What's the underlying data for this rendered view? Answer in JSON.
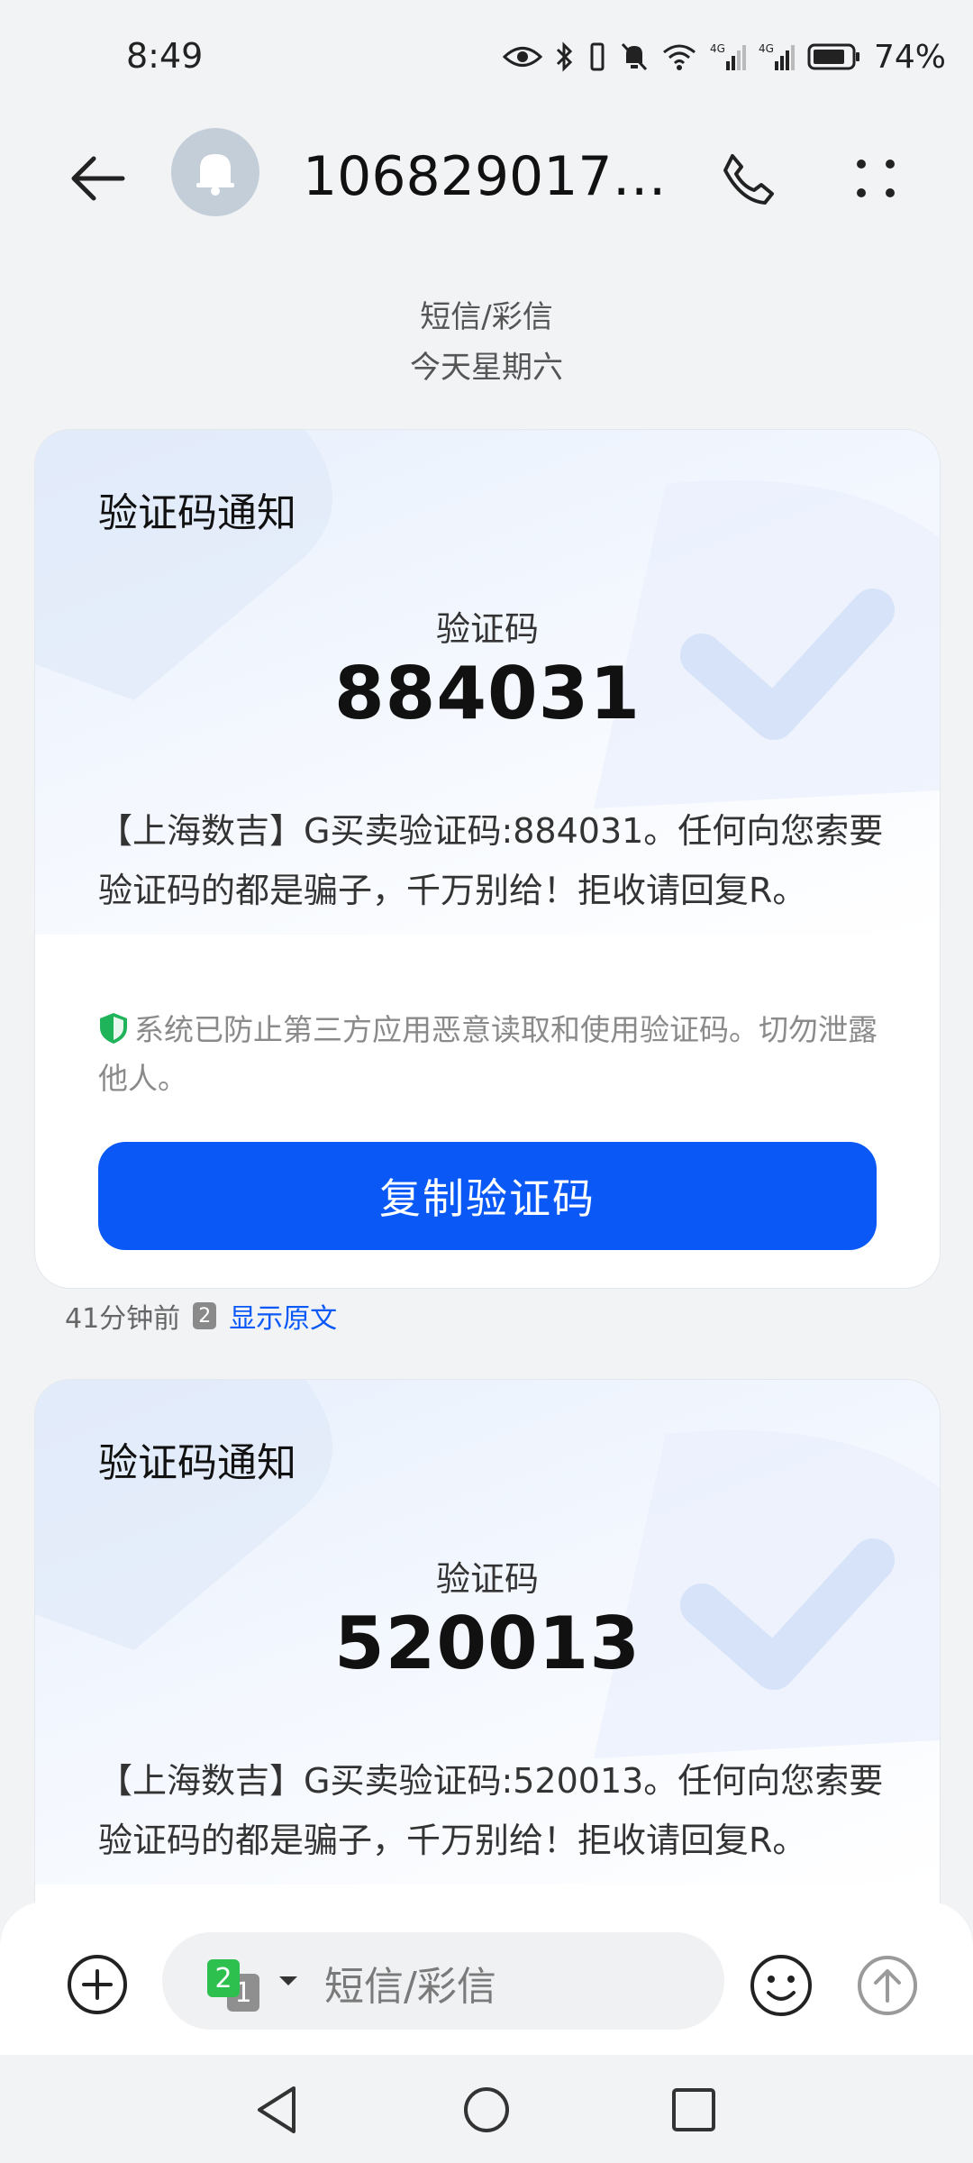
{
  "status_bar": {
    "time": "8:49",
    "battery_percent": "74%",
    "network_1": "4G",
    "network_2": "4G"
  },
  "header": {
    "contact": "1068290171..."
  },
  "conversation": {
    "type_label": "短信/彩信",
    "date_label": "今天星期六"
  },
  "messages": [
    {
      "card_title": "验证码通知",
      "code_label": "验证码",
      "code": "884031",
      "body": "【上海数吉】G买卖验证码:884031。任何向您索要验证码的都是骗子，千万别给！拒收请回复R。",
      "notice": "系统已防止第三方应用恶意读取和使用验证码。切勿泄露他人。",
      "copy_button": "复制验证码",
      "time": "41分钟前",
      "sim": "2",
      "show_original": "显示原文"
    },
    {
      "card_title": "验证码通知",
      "code_label": "验证码",
      "code": "520013",
      "body": "【上海数吉】G买卖验证码:520013。任何向您索要验证码的都是骗子，千万别给！拒收请回复R。"
    }
  ],
  "composer": {
    "placeholder": "短信/彩信",
    "sim_primary": "2",
    "sim_secondary": "1"
  },
  "colors": {
    "accent": "#0a59f7",
    "shield_green": "#1fb35a"
  }
}
